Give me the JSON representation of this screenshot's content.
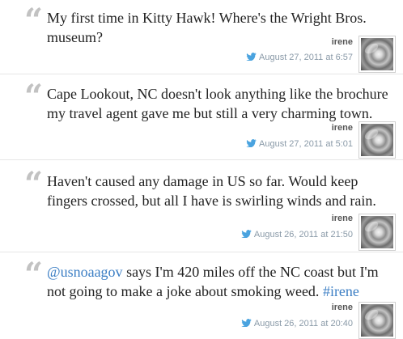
{
  "tweets": [
    {
      "text": "My first time in Kitty Hawk! Where's the Wright Bros. museum?",
      "author": "irene",
      "timestamp": "August 27, 2011 at 6:57"
    },
    {
      "text": "Cape Lookout, NC doesn't look anything like the brochure my travel agent gave me but still a very charming town.",
      "author": "irene",
      "timestamp": "August 27, 2011 at 5:01"
    },
    {
      "text": "Haven't caused any damage in US so far. Would keep fingers crossed, but all I have is swirling winds and rain.",
      "author": "irene",
      "timestamp": "August 26, 2011 at 21:50"
    },
    {
      "mention": "@usnoaagov",
      "text_middle": " says I'm 420 miles off the NC coast but I'm not going to make a joke about smoking weed. ",
      "hashtag": "#irene",
      "author": "irene",
      "timestamp": "August 26, 2011 at 20:40"
    }
  ],
  "quote_glyph": "“",
  "icons": {
    "bird": "twitter-bird-icon",
    "avatar": "hurricane-satellite-avatar"
  },
  "colors": {
    "link": "#3b7ec4",
    "bird": "#4aa3df",
    "quote": "#c2c2c2",
    "timestamp": "#8a9aa8"
  }
}
